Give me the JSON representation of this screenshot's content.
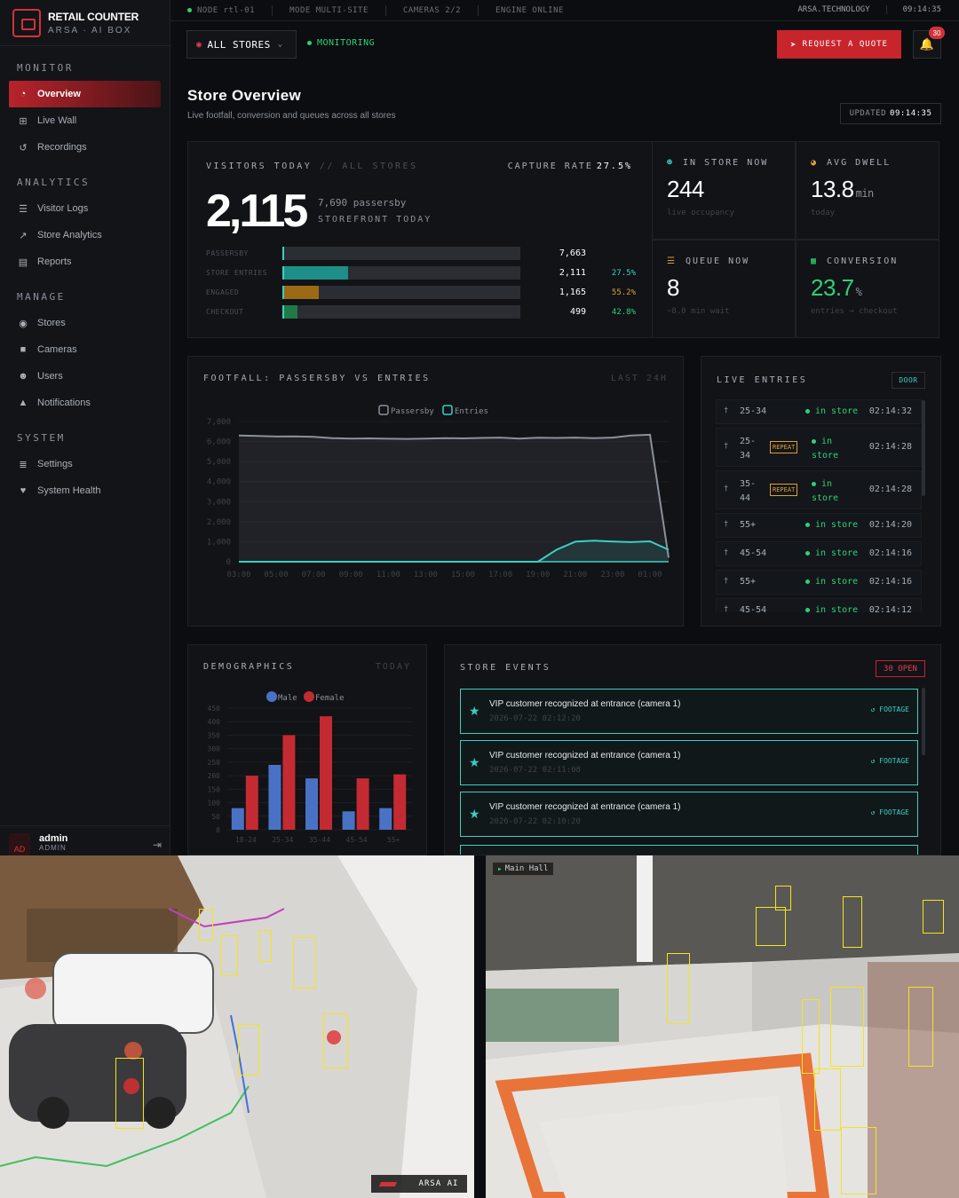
{
  "brand": {
    "title": "RETAIL COUNTER",
    "subtitle": "ARSA · AI BOX"
  },
  "nav": {
    "sections": [
      {
        "label": "MONITOR",
        "items": [
          {
            "label": "Overview",
            "icon": "gauge-icon",
            "active": true
          },
          {
            "label": "Live Wall",
            "icon": "grid-icon"
          },
          {
            "label": "Recordings",
            "icon": "history-icon"
          }
        ]
      },
      {
        "label": "ANALYTICS",
        "items": [
          {
            "label": "Visitor Logs",
            "icon": "list-icon"
          },
          {
            "label": "Store Analytics",
            "icon": "chart-line-icon"
          },
          {
            "label": "Reports",
            "icon": "file-icon"
          }
        ]
      },
      {
        "label": "MANAGE",
        "items": [
          {
            "label": "Stores",
            "icon": "map-pin-icon"
          },
          {
            "label": "Cameras",
            "icon": "video-icon"
          },
          {
            "label": "Users",
            "icon": "users-icon"
          },
          {
            "label": "Notifications",
            "icon": "bell-icon"
          }
        ]
      },
      {
        "label": "SYSTEM",
        "items": [
          {
            "label": "Settings",
            "icon": "sliders-icon"
          },
          {
            "label": "System Health",
            "icon": "heart-pulse-icon"
          }
        ]
      }
    ]
  },
  "user": {
    "initials": "AD",
    "name": "admin",
    "role": "ADMIN"
  },
  "statusbar": {
    "node": "NODE rtl-01",
    "mode": "MODE MULTI-SITE",
    "cameras": "CAMERAS 2/2",
    "engine": "ENGINE ONLINE",
    "site": "ARSA.TECHNOLOGY",
    "clock": "09:14:35"
  },
  "toolbar": {
    "store_select": "ALL STORES",
    "monitoring": "MONITORING",
    "quote": "REQUEST A QUOTE",
    "notifications": "30"
  },
  "header": {
    "title": "Store Overview",
    "subtitle": "Live footfall, conversion and queues across all stores",
    "updated_label": "UPDATED",
    "updated_time": "09:14:35"
  },
  "visitors": {
    "title": "VISITORS TODAY",
    "scope": "// ALL STORES",
    "capture_label": "CAPTURE RATE",
    "capture_rate": "27.5%",
    "total": "2,115",
    "passersby": "7,690 passersby",
    "storefront": "STOREFRONT TODAY",
    "funnel": [
      {
        "label": "PASSERSBY",
        "value": "7,663",
        "fraction": 1.0,
        "color": "#2a2d32",
        "pct": "",
        "pct_color": "#3ad0c0"
      },
      {
        "label": "STORE ENTRIES",
        "value": "2,111",
        "fraction": 0.275,
        "color": "#1e8f88",
        "pct": "27.5%",
        "pct_color": "#3ad0c0"
      },
      {
        "label": "ENGAGED",
        "value": "1,165",
        "fraction": 0.152,
        "color": "#9a6a14",
        "pct": "55.2%",
        "pct_color": "#e0a030"
      },
      {
        "label": "CHECKOUT",
        "value": "499",
        "fraction": 0.065,
        "color": "#1f7a46",
        "pct": "42.8%",
        "pct_color": "#2ed17a"
      }
    ]
  },
  "kpis": [
    {
      "label": "IN STORE NOW",
      "icon": "people-icon",
      "icon_color": "#3ad0c0",
      "value": "244",
      "unit": "",
      "sub": "live occupancy",
      "color": "#fff"
    },
    {
      "label": "AVG DWELL",
      "icon": "stopwatch-icon",
      "icon_color": "#e0a030",
      "value": "13.8",
      "unit": "min",
      "sub": "today",
      "color": "#fff"
    },
    {
      "label": "QUEUE NOW",
      "icon": "queue-icon",
      "icon_color": "#e0a030",
      "value": "8",
      "unit": "",
      "sub": "~8.0 min wait",
      "color": "#fff"
    },
    {
      "label": "CONVERSION",
      "icon": "cash-register-icon",
      "icon_color": "#2ed17a",
      "value": "23.7",
      "unit": "%",
      "sub": "entries → checkout",
      "color": "#2ed17a"
    }
  ],
  "footfall": {
    "title": "FOOTFALL: PASSERSBY VS ENTRIES",
    "range": "LAST 24H"
  },
  "chart_data": [
    {
      "type": "area",
      "title": "FOOTFALL: PASSERSBY VS ENTRIES",
      "legend": "top-center",
      "ylim": [
        0,
        7000
      ],
      "yticks": [
        "7,000",
        "6,000",
        "5,000",
        "4,000",
        "3,000",
        "2,000",
        "1,000",
        "0"
      ],
      "x": [
        "03:00",
        "04:00",
        "05:00",
        "06:00",
        "07:00",
        "08:00",
        "09:00",
        "10:00",
        "11:00",
        "12:00",
        "13:00",
        "14:00",
        "15:00",
        "16:00",
        "17:00",
        "18:00",
        "19:00",
        "20:00",
        "21:00",
        "22:00",
        "23:00",
        "00:00",
        "01:00",
        "02:00"
      ],
      "xticks": [
        "03:00",
        "05:00",
        "07:00",
        "09:00",
        "11:00",
        "13:00",
        "15:00",
        "17:00",
        "19:00",
        "21:00",
        "23:00",
        "01:00"
      ],
      "series": [
        {
          "name": "Passersby",
          "color": "#8b919a",
          "values": [
            6300,
            6280,
            6250,
            6260,
            6240,
            6170,
            6150,
            6160,
            6140,
            6130,
            6150,
            6170,
            6160,
            6180,
            6200,
            6150,
            6190,
            6180,
            6200,
            6170,
            6200,
            6300,
            6340,
            200
          ]
        },
        {
          "name": "Entries",
          "color": "#3ad0c0",
          "values": [
            0,
            0,
            0,
            0,
            0,
            0,
            0,
            0,
            0,
            0,
            0,
            0,
            0,
            0,
            0,
            0,
            0,
            600,
            1000,
            1050,
            1010,
            980,
            1020,
            600
          ]
        }
      ]
    },
    {
      "type": "bar",
      "title": "DEMOGRAPHICS",
      "legend": "top-center",
      "ylim": [
        0,
        450
      ],
      "yticks": [
        "450",
        "400",
        "350",
        "300",
        "250",
        "200",
        "150",
        "100",
        "50",
        "0"
      ],
      "categories": [
        "18-24",
        "25-34",
        "35-44",
        "45-54",
        "55+"
      ],
      "series": [
        {
          "name": "Male",
          "color": "#4a72c4",
          "values": [
            80,
            240,
            190,
            68,
            80
          ]
        },
        {
          "name": "Female",
          "color": "#c42a32",
          "values": [
            200,
            350,
            420,
            190,
            205
          ]
        }
      ]
    }
  ],
  "live_entries": {
    "title": "LIVE ENTRIES",
    "door": "DOOR",
    "rows": [
      {
        "age": "25-34",
        "repeat": "",
        "status": "in store",
        "time": "02:14:32"
      },
      {
        "age": "25-34",
        "repeat": "REPEAT",
        "status": "in store",
        "time": "02:14:28"
      },
      {
        "age": "35-44",
        "repeat": "REPEAT",
        "status": "in store",
        "time": "02:14:28"
      },
      {
        "age": "55+",
        "repeat": "",
        "status": "in store",
        "time": "02:14:20"
      },
      {
        "age": "45-54",
        "repeat": "",
        "status": "in store",
        "time": "02:14:16"
      },
      {
        "age": "55+",
        "repeat": "",
        "status": "in store",
        "time": "02:14:16"
      },
      {
        "age": "45-54",
        "repeat": "",
        "status": "in store",
        "time": "02:14:12"
      }
    ]
  },
  "demographics": {
    "title": "DEMOGRAPHICS",
    "today": "TODAY"
  },
  "events": {
    "title": "STORE EVENTS",
    "open": "30 OPEN",
    "items": [
      {
        "text": "VIP customer recognized at entrance (camera 1)",
        "date": "2026-07-22 02:12:20",
        "action": "FOOTAGE"
      },
      {
        "text": "VIP customer recognized at entrance (camera 1)",
        "date": "2026-07-22 02:11:08",
        "action": "FOOTAGE"
      },
      {
        "text": "VIP customer recognized at entrance (camera 1)",
        "date": "2026-07-22 02:10:20",
        "action": "FOOTAGE"
      }
    ]
  },
  "cameras": {
    "left_badge": "ARSA AI",
    "right_label": "Main Hall"
  }
}
